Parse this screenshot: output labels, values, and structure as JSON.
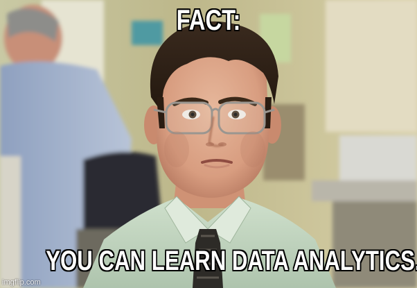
{
  "meme": {
    "top_text": "FACT:",
    "bottom_text": "YOU CAN LEARN DATA ANALYTICS.",
    "watermark": "imgflip.com"
  },
  "colors": {
    "caption_fill": "#ffffff",
    "caption_outline": "#000000"
  }
}
